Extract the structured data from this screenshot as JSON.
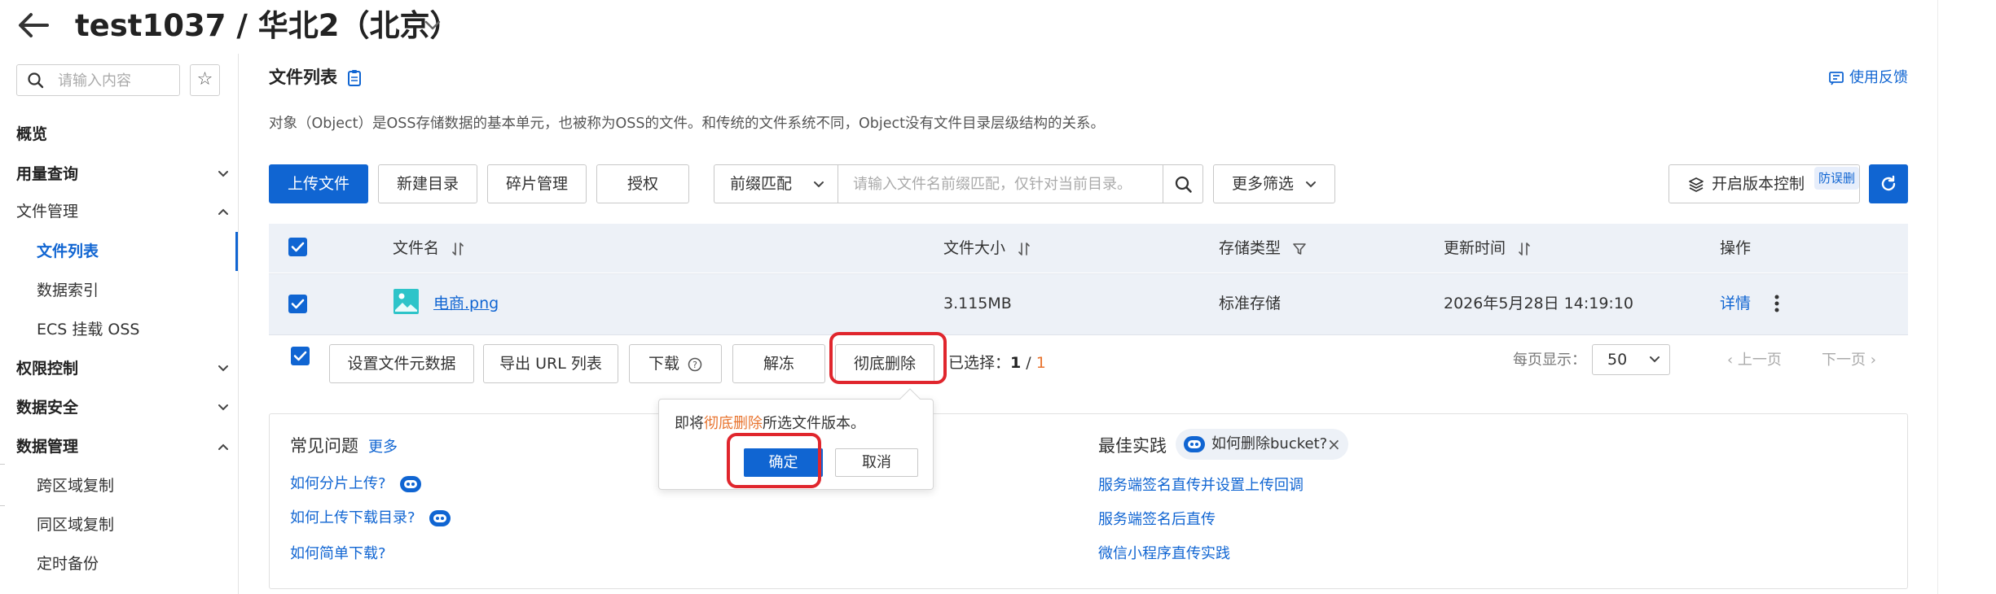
{
  "header": {
    "back_icon": "arrow-left-icon",
    "title": "test1037 / 华北2（北京）",
    "switch_icon": "chevron-down-icon"
  },
  "sidebar": {
    "search_placeholder": "请输入内容",
    "star_icon": "star-icon",
    "items": [
      {
        "label": "概览"
      },
      {
        "label": "用量查询"
      },
      {
        "label": "文件管理"
      },
      {
        "label": "文件列表"
      },
      {
        "label": "数据索引"
      },
      {
        "label": "ECS 挂载 OSS"
      },
      {
        "label": "权限控制"
      },
      {
        "label": "数据安全"
      },
      {
        "label": "数据管理"
      },
      {
        "label": "跨区域复制"
      },
      {
        "label": "同区域复制"
      },
      {
        "label": "定时备份"
      }
    ]
  },
  "main": {
    "title": "文件列表",
    "feedback": "使用反馈",
    "description": "对象（Object）是OSS存储数据的基本单元，也被称为OSS的文件。和传统的文件系统不同，Object没有文件目录层级结构的关系。"
  },
  "toolbar": {
    "upload": "上传文件",
    "new_dir": "新建目录",
    "fragments": "碎片管理",
    "authorize": "授权",
    "prefix_select": "前缀匹配",
    "search_placeholder": "请输入文件名前缀匹配，仅针对当前目录。",
    "more_filter": "更多筛选",
    "version_control": "开启版本控制",
    "version_badge": "防误删"
  },
  "table": {
    "columns": [
      "文件名",
      "文件大小",
      "存储类型",
      "更新时间",
      "操作"
    ],
    "rows": [
      {
        "name": "电商.png",
        "size": "3.115MB",
        "storage": "标准存储",
        "updated": "2026年5月28日 14:19:10",
        "action": "详情"
      }
    ]
  },
  "bulk": {
    "set_meta": "设置文件元数据",
    "export_urls": "导出 URL 列表",
    "download": "下载",
    "unfreeze": "解冻",
    "delete": "彻底删除",
    "selected_label": "已选择：",
    "selected_count": "1",
    "selected_sep": " / ",
    "selected_total": "1",
    "per_page_label": "每页显示：",
    "per_page": "50",
    "prev": "上一页",
    "next": "下一页"
  },
  "popover": {
    "text_before": "即将",
    "text_highlight": "彻底删除",
    "text_after": "所选文件版本。",
    "confirm": "确定",
    "cancel": "取消"
  },
  "faq": {
    "title": "常见问题",
    "more": "更多",
    "links": [
      "如何分片上传?",
      "如何上传下载目录?",
      "如何简单下载?"
    ]
  },
  "best_practice": {
    "title": "最佳实践",
    "chip": "如何删除bucket?",
    "links": [
      "服务端签名直传并设置上传回调",
      "服务端签名后直传",
      "微信小程序直传实践"
    ]
  },
  "colors": {
    "primary": "#1065d2",
    "highlight_red": "#e0262d",
    "orange": "#e8742f",
    "table_bg": "#edf1f7"
  }
}
